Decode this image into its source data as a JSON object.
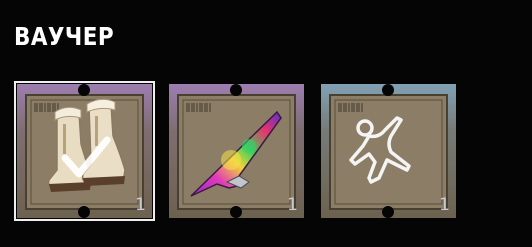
{
  "section": {
    "title": "ВАУЧЕР"
  },
  "vouchers": [
    {
      "item": "fur-boots-icon",
      "count": "1",
      "rarity_color": "#b98fe6",
      "selected": true,
      "checked": true
    },
    {
      "item": "tie-dye-glider-icon",
      "count": "1",
      "rarity_color": "#b98fe6",
      "selected": false,
      "checked": false
    },
    {
      "item": "chalk-outline-icon",
      "count": "1",
      "rarity_color": "#8ec6ec",
      "selected": false,
      "checked": false
    }
  ]
}
